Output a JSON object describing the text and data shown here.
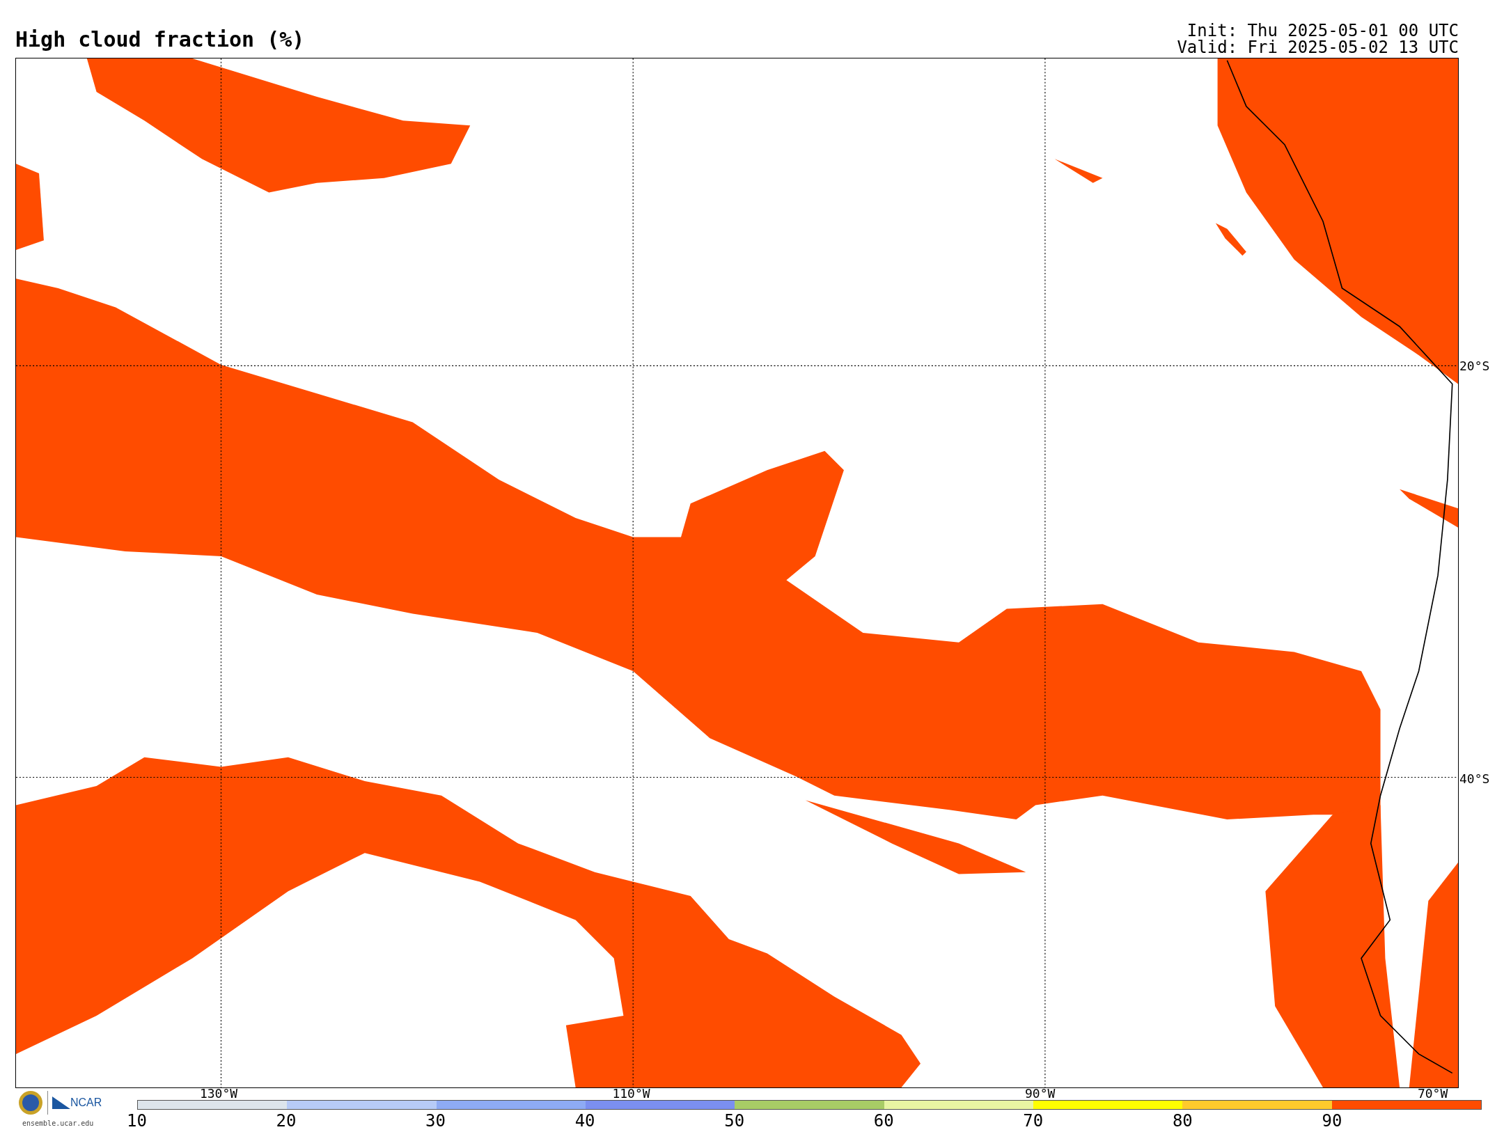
{
  "title": "High cloud fraction (%)",
  "init": "Init: Thu 2025-05-01 00 UTC",
  "valid": "Valid: Fri 2025-05-02 13 UTC",
  "lat_labels": [
    "20°S",
    "40°S"
  ],
  "lon_labels": [
    "130°W",
    "110°W",
    "90°W",
    "70°W"
  ],
  "logo": {
    "org": "NCAR",
    "url": "ensemble.ucar.edu"
  },
  "colorbar": {
    "ticks": [
      "10",
      "20",
      "30",
      "40",
      "50",
      "60",
      "70",
      "80",
      "90"
    ],
    "segments": [
      {
        "color": "#dde5ec"
      },
      {
        "color": "#b7cbf7"
      },
      {
        "color": "#8eabf4"
      },
      {
        "color": "#7b8ff0"
      },
      {
        "color": "#a8cc66"
      },
      {
        "color": "#e8f5a3"
      },
      {
        "color": "#ffff00"
      },
      {
        "color": "#ffca2c"
      },
      {
        "color": "#ff4c00"
      }
    ]
  }
}
